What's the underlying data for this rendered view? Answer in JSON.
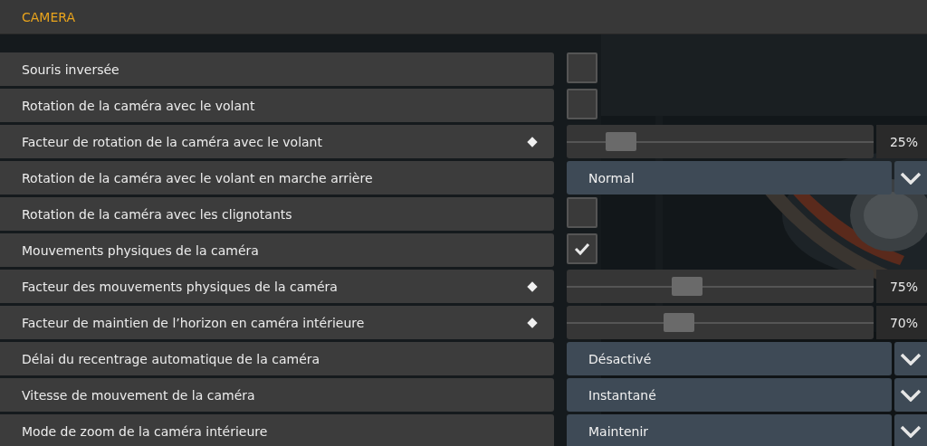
{
  "section": {
    "title": "CAMERA"
  },
  "settings": [
    {
      "kind": "checkbox",
      "label": "Souris inversée",
      "checked": false
    },
    {
      "kind": "checkbox",
      "label": "Rotation de la caméra avec le volant",
      "checked": false
    },
    {
      "kind": "slider",
      "label": "Facteur de rotation de la caméra avec le volant",
      "level": 0.14,
      "reading": "25%"
    },
    {
      "kind": "dropdown",
      "label": "Rotation de la caméra avec le volant en marche arrière",
      "value": "Normal"
    },
    {
      "kind": "checkbox",
      "label": "Rotation de la caméra avec les clignotants",
      "checked": false
    },
    {
      "kind": "checkbox",
      "label": "Mouvements physiques de la caméra",
      "checked": true
    },
    {
      "kind": "slider",
      "label": "Facteur des mouvements physiques de la caméra",
      "level": 0.38,
      "reading": "75%"
    },
    {
      "kind": "slider",
      "label": "Facteur de maintien de l’horizon en caméra intérieure",
      "level": 0.35,
      "reading": "70%"
    },
    {
      "kind": "dropdown",
      "label": "Délai du recentrage automatique de la caméra",
      "value": "Désactivé"
    },
    {
      "kind": "dropdown",
      "label": "Vitesse de mouvement de la caméra",
      "value": "Instantané"
    },
    {
      "kind": "dropdown",
      "label": "Mode de zoom de la caméra intérieure",
      "value": "Maintenir"
    }
  ]
}
